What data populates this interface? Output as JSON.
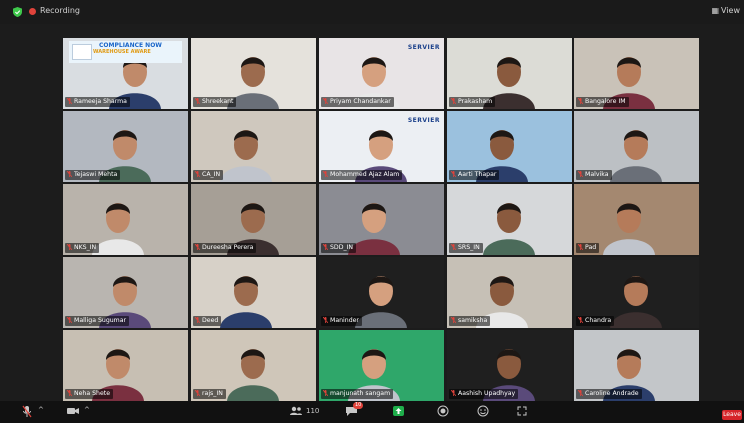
{
  "topbar": {
    "recording_label": "Recording",
    "view_label": "View"
  },
  "colors": {
    "background": "#1c1c1c",
    "speaking_border": "#3ec94b",
    "record_dot": "#e0433b",
    "leave_button": "#d6252a",
    "share_button": "#1fae4b"
  },
  "banner": {
    "title_line1": "COMPLIANCE NOW",
    "title_line2": "WAREHOUSE AWARE"
  },
  "servier_logo": "SERVIER",
  "participants": [
    {
      "name": "Rameeja Sharma",
      "bg": "#d9dde1"
    },
    {
      "name": "Shreekant",
      "bg": "#e5e2dc"
    },
    {
      "name": "Priyam Chandankar",
      "bg": "#e8e4e6"
    },
    {
      "name": "Prakasham",
      "bg": "#dcdcd6"
    },
    {
      "name": "Bangalore IM",
      "bg": "#c9c2b8"
    },
    {
      "name": "Tejaswi Mehta",
      "bg": "#b3b8c0"
    },
    {
      "name": "CA_IN",
      "bg": "#cfc8be"
    },
    {
      "name": "Mohammed Ajaz Alam",
      "bg": "#eceff3"
    },
    {
      "name": "Aarti Thapar",
      "bg": "#9bc1de"
    },
    {
      "name": "Malvika",
      "bg": "#bcc0c4"
    },
    {
      "name": "NKS_IN",
      "bg": "#b9b3ab"
    },
    {
      "name": "Dureesha Perera",
      "bg": "#a69f96"
    },
    {
      "name": "SDD_IN",
      "bg": "#8b8c93"
    },
    {
      "name": "SRS_IN",
      "bg": "#d6d8da"
    },
    {
      "name": "Pad",
      "bg": "#a48870"
    },
    {
      "name": "Malliga Sugumar",
      "bg": "#b9b5b0"
    },
    {
      "name": "Deed",
      "bg": "#d7d1c8"
    },
    {
      "name": "Maninder",
      "bg": "#1f1f1f"
    },
    {
      "name": "samiksha",
      "bg": "#c6c0b6"
    },
    {
      "name": "Chandra",
      "bg": "#1f1f1f"
    },
    {
      "name": "Neha Shete",
      "bg": "#c7bfb3"
    },
    {
      "name": "rajs_IN",
      "bg": "#cfc6b9"
    },
    {
      "name": "manjunath sangam",
      "bg": "#2fa76a"
    },
    {
      "name": "Aashish Upadhyay",
      "bg": "#1f1f1f"
    },
    {
      "name": "Caroline Andrade",
      "bg": "#c3c6c9"
    }
  ],
  "toolbar": {
    "participants_count": "110",
    "chat_badge": "10",
    "leave_label": "Leave"
  }
}
